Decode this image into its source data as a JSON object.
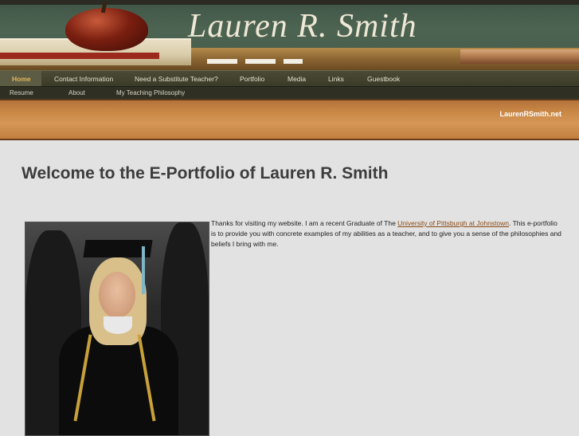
{
  "header": {
    "site_title": "Lauren R. Smith"
  },
  "nav_primary": {
    "items": [
      {
        "label": "Home",
        "active": true
      },
      {
        "label": "Contact Information"
      },
      {
        "label": "Need a Substitute Teacher?"
      },
      {
        "label": "Portfolio"
      },
      {
        "label": "Media"
      },
      {
        "label": "Links"
      },
      {
        "label": "Guestbook"
      }
    ]
  },
  "nav_secondary": {
    "items": [
      {
        "label": "Resume"
      },
      {
        "label": "About"
      },
      {
        "label": "My Teaching Philosophy"
      }
    ]
  },
  "banner_bar": {
    "domain": "LaurenRSmith.net"
  },
  "main": {
    "heading": "Welcome to the E-Portfolio of Lauren R. Smith",
    "intro_before": "Thanks for visiting my website. I am a recent Graduate of  The ",
    "intro_link": "University of Pittsburgh at Johnstown",
    "intro_after": ". This e-portfolio is to provide you with concrete examples of my abilities as a teacher, and to give you a sense of the philosophies and beliefs I bring with me."
  },
  "colors": {
    "nav_active": "#e2b659",
    "link": "#8a4a16",
    "accent_bar": "#cc8a48"
  }
}
